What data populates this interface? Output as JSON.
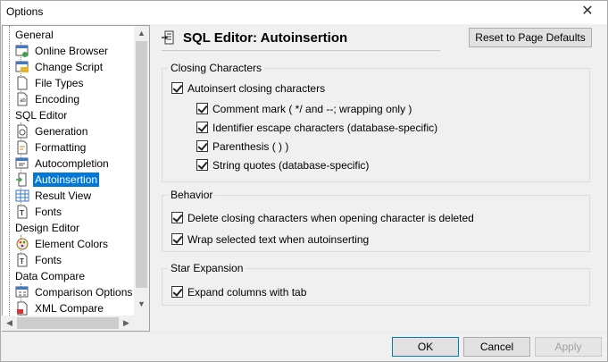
{
  "window": {
    "title": "Options",
    "close_glyph": "✕"
  },
  "tree": {
    "sections": [
      {
        "label": "General",
        "children": [
          "Online Browser",
          "Change Script",
          "File Types",
          "Encoding"
        ]
      },
      {
        "label": "SQL Editor",
        "children": [
          "Generation",
          "Formatting",
          "Autocompletion",
          "Autoinsertion",
          "Result View",
          "Fonts"
        ]
      },
      {
        "label": "Design Editor",
        "children": [
          "Element Colors",
          "Fonts"
        ]
      },
      {
        "label": "Data Compare",
        "children": [
          "Comparison Options",
          "XML Compare"
        ]
      }
    ],
    "selected": "Autoinsertion"
  },
  "page": {
    "title": "SQL Editor: Autoinsertion",
    "reset_label": "Reset to Page Defaults",
    "icon": "autoinsertion-icon"
  },
  "groups": {
    "closing": {
      "label": "Closing Characters",
      "autoinsert": "Autoinsert closing characters",
      "comment": "Comment mark ( */ and --; wrapping only )",
      "identifier": "Identifier escape characters (database-specific)",
      "parenthesis": "Parenthesis ( ) )",
      "string": "String quotes (database-specific)"
    },
    "behavior": {
      "label": "Behavior",
      "delete": "Delete closing characters when opening character is deleted",
      "wrap": "Wrap selected text when autoinserting"
    },
    "star": {
      "label": "Star Expansion",
      "expand": "Expand columns with tab"
    }
  },
  "buttons": {
    "ok": "OK",
    "cancel": "Cancel",
    "apply": "Apply"
  },
  "colors": {
    "selection": "#0078d7",
    "default_button_border": "#0078d7"
  }
}
